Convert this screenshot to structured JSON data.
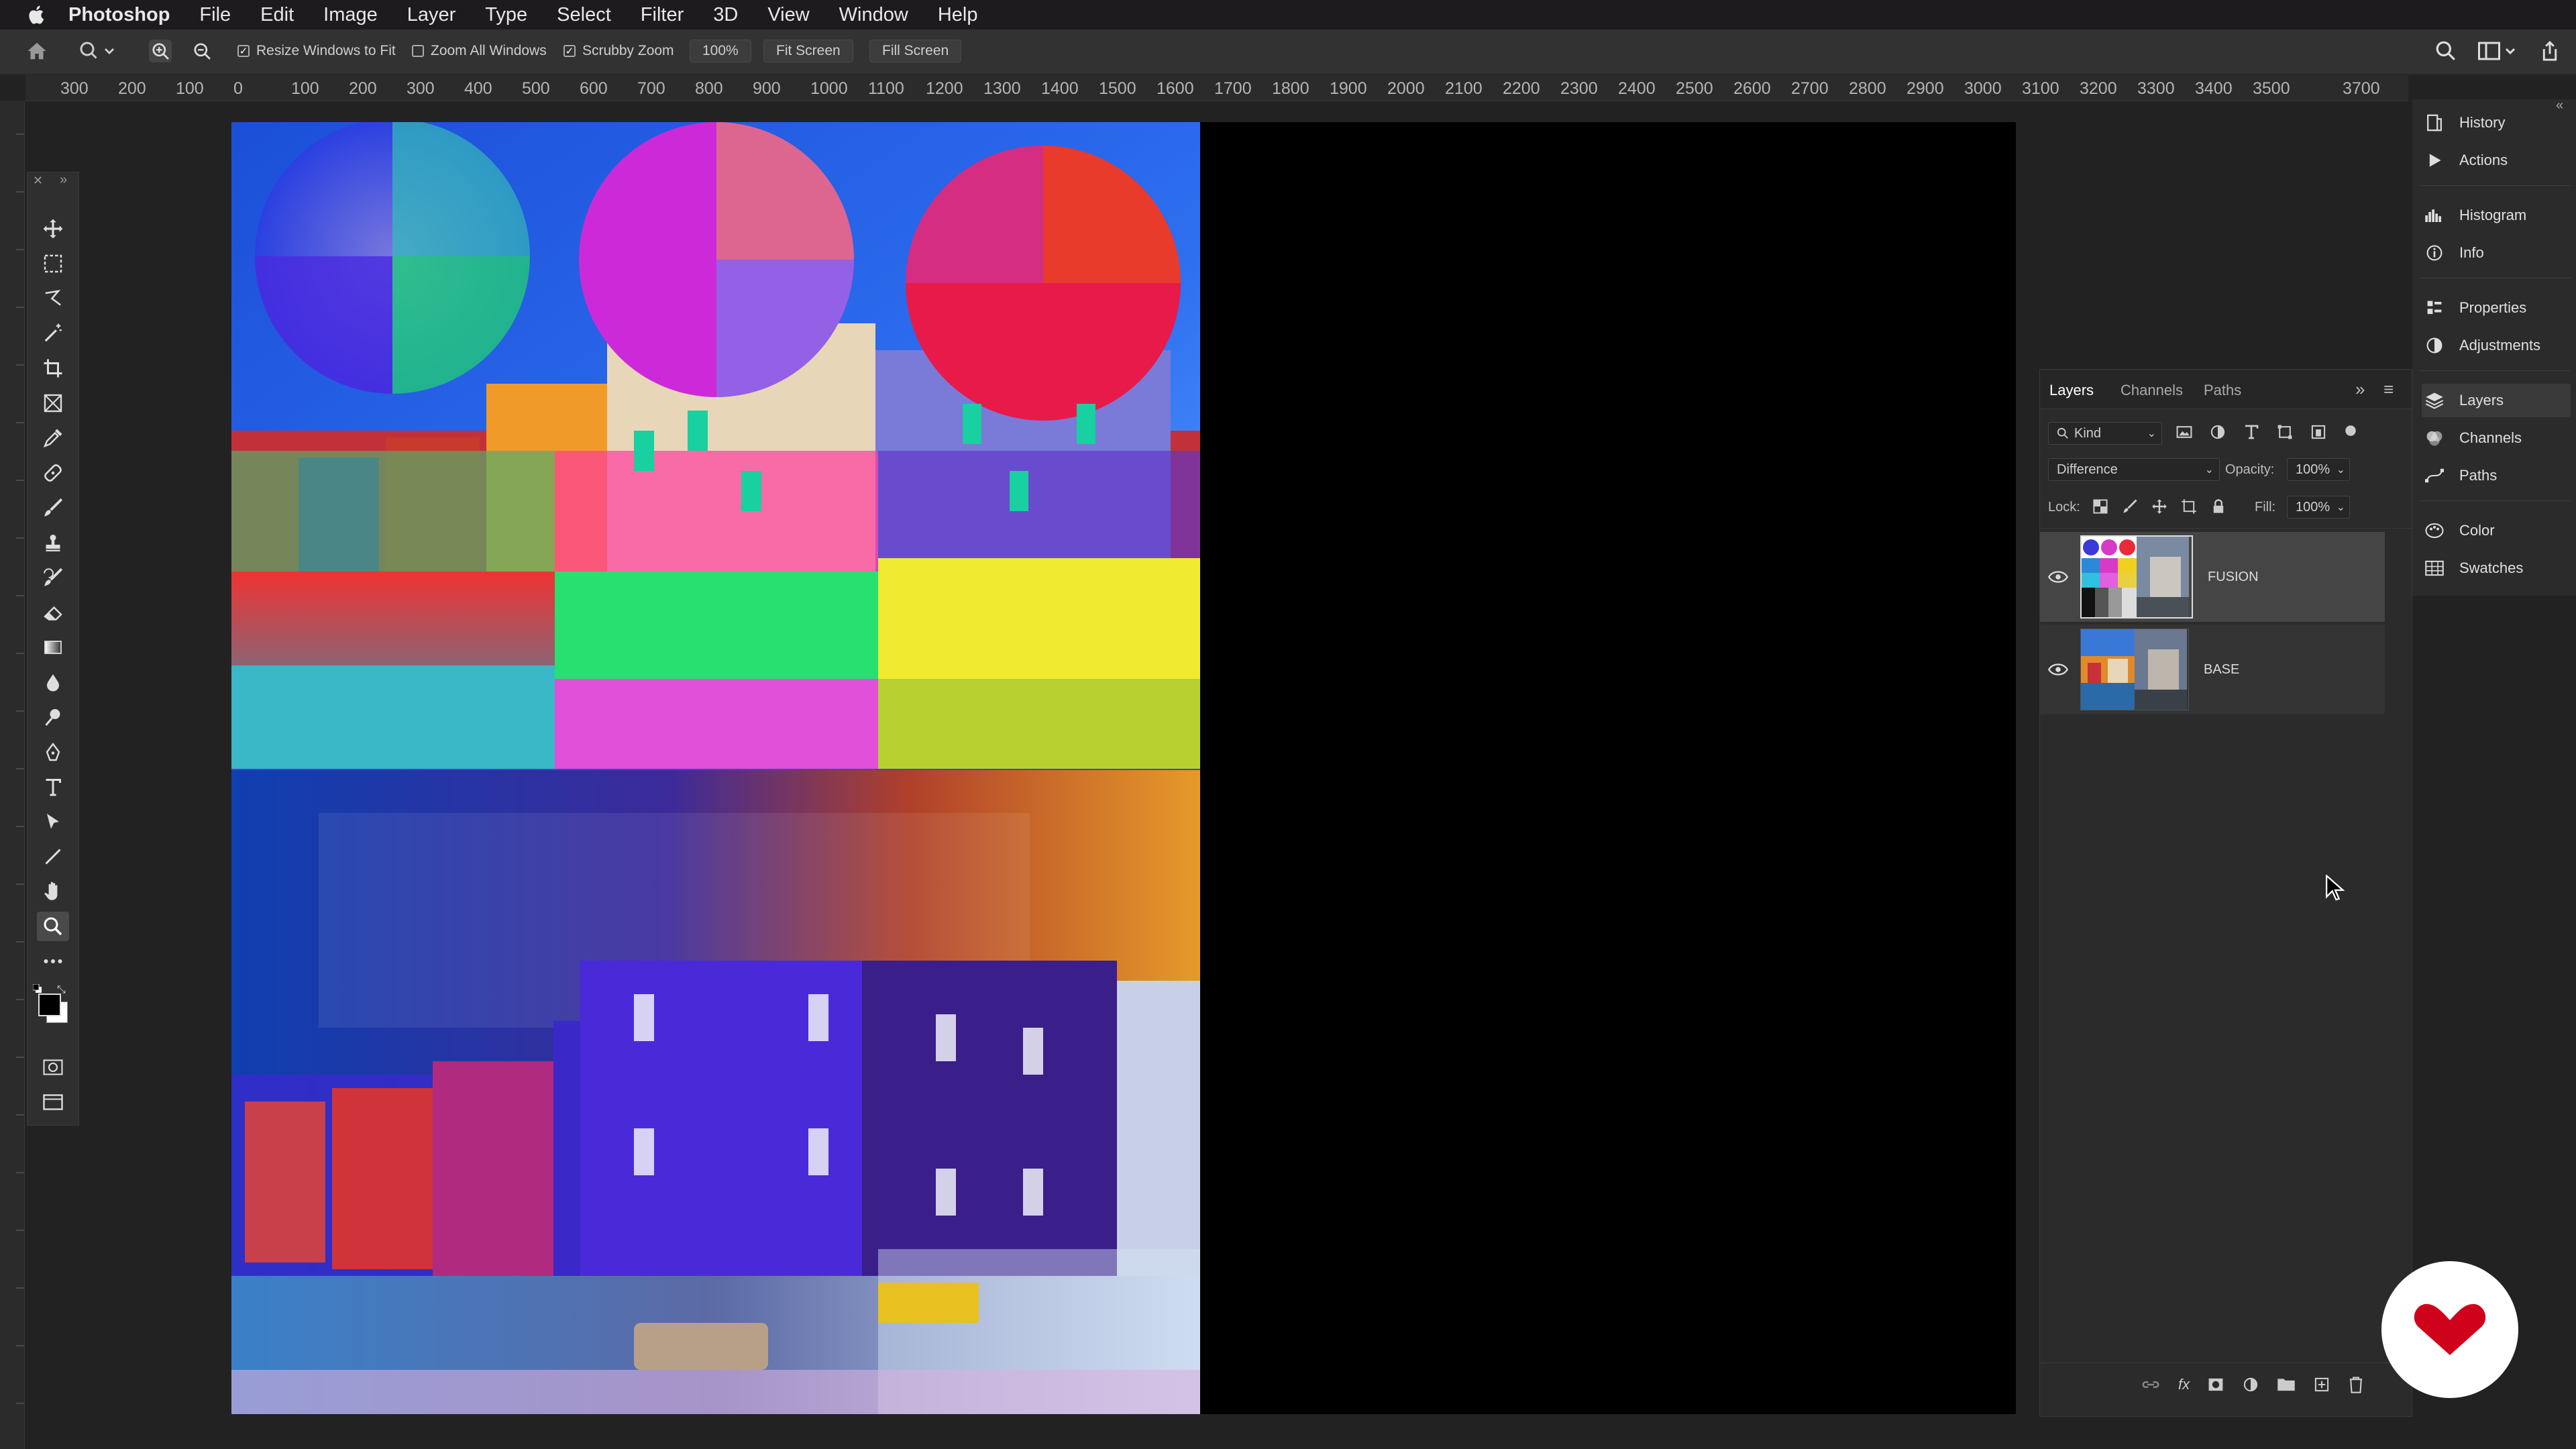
{
  "menubar": {
    "app_name": "Photoshop",
    "items": [
      "File",
      "Edit",
      "Image",
      "Layer",
      "Type",
      "Select",
      "Filter",
      "3D",
      "View",
      "Window",
      "Help"
    ]
  },
  "options_bar": {
    "resize_windows": "Resize Windows to Fit",
    "zoom_all_windows": "Zoom All Windows",
    "scrubby_zoom": "Scrubby Zoom",
    "zoom_level": "100%",
    "fit_screen": "Fit Screen",
    "fill_screen": "Fill Screen"
  },
  "ruler": {
    "h_ticks": [
      "300",
      "200",
      "100",
      "0",
      "100",
      "200",
      "300",
      "400",
      "500",
      "600",
      "700",
      "800",
      "900",
      "1000",
      "1100",
      "1200",
      "1300",
      "1400",
      "1500",
      "1600",
      "1700",
      "1800",
      "1900",
      "2000",
      "2100",
      "2200",
      "2300",
      "2400",
      "2500",
      "2600",
      "2700",
      "2800",
      "2900",
      "3000",
      "3100",
      "3200",
      "3300",
      "3400",
      "3500",
      "3700"
    ]
  },
  "layers_panel": {
    "tabs": [
      "Layers",
      "Channels",
      "Paths"
    ],
    "filter_kind": "Kind",
    "blend_mode": "Difference",
    "opacity_label": "Opacity:",
    "opacity_value": "100%",
    "lock_label": "Lock:",
    "fill_label": "Fill:",
    "fill_value": "100%",
    "layers": [
      {
        "name": "FUSION",
        "selected": true,
        "visible": true
      },
      {
        "name": "BASE",
        "selected": false,
        "visible": true
      }
    ]
  },
  "dock": {
    "items": [
      {
        "label": "History",
        "icon": "history-icon"
      },
      {
        "label": "Actions",
        "icon": "actions-icon"
      },
      {
        "label": "Histogram",
        "icon": "histogram-icon"
      },
      {
        "label": "Info",
        "icon": "info-icon"
      },
      {
        "label": "Properties",
        "icon": "properties-icon"
      },
      {
        "label": "Adjustments",
        "icon": "adjustments-icon"
      },
      {
        "label": "Layers",
        "icon": "layers-icon"
      },
      {
        "label": "Channels",
        "icon": "channels-icon"
      },
      {
        "label": "Paths",
        "icon": "paths-icon"
      },
      {
        "label": "Color",
        "icon": "color-icon"
      },
      {
        "label": "Swatches",
        "icon": "swatches-icon"
      }
    ]
  },
  "colors": {
    "accent_logo": "#d0021b",
    "canvas_bg": "#000000",
    "panel_bg": "#2b2b2b"
  }
}
